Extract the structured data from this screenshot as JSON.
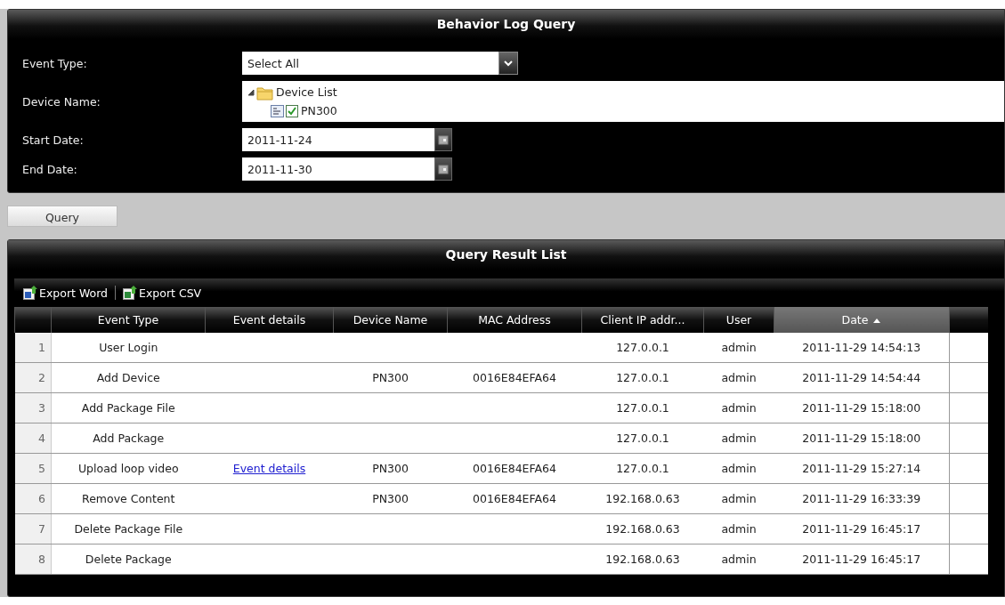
{
  "query_panel": {
    "title": "Behavior Log Query",
    "event_type": {
      "label": "Event Type:",
      "value": "Select All"
    },
    "device_name": {
      "label": "Device Name:",
      "tree": [
        {
          "label": "Device List",
          "expanded": true,
          "children": [
            {
              "label": "PN300",
              "checked": true
            }
          ]
        }
      ]
    },
    "start_date": {
      "label": "Start Date:",
      "value": "2011-11-24"
    },
    "end_date": {
      "label": "End Date:",
      "value": "2011-11-30"
    }
  },
  "query_button": "Query",
  "result_panel": {
    "title": "Query Result List",
    "toolbar": [
      {
        "label": "Export Word",
        "kind": "word"
      },
      {
        "label": "Export CSV",
        "kind": "excel"
      }
    ],
    "table": {
      "columns": [
        {
          "label": "Event Type",
          "sorted": false
        },
        {
          "label": "Event details",
          "sorted": false
        },
        {
          "label": "Device Name",
          "sorted": false
        },
        {
          "label": "MAC Address",
          "sorted": false
        },
        {
          "label": "Client IP addr...",
          "sorted": false
        },
        {
          "label": "User",
          "sorted": false
        },
        {
          "label": "Date",
          "sorted": true
        }
      ],
      "rows": [
        {
          "number": "1",
          "cells": [
            "User Login",
            null,
            null,
            null,
            "127.0.0.1",
            "admin",
            "2011-11-29 14:54:13"
          ]
        },
        {
          "number": "2",
          "cells": [
            "Add Device",
            null,
            "PN300",
            "0016E84EFA64",
            "127.0.0.1",
            "admin",
            "2011-11-29 14:54:44"
          ]
        },
        {
          "number": "3",
          "cells": [
            "Add Package File",
            null,
            null,
            null,
            "127.0.0.1",
            "admin",
            "2011-11-29 15:18:00"
          ]
        },
        {
          "number": "4",
          "cells": [
            "Add Package",
            null,
            null,
            null,
            "127.0.0.1",
            "admin",
            "2011-11-29 15:18:00"
          ]
        },
        {
          "number": "5",
          "cells": [
            "Upload loop video",
            {
              "text": "Event details",
              "kind": "link"
            },
            "PN300",
            "0016E84EFA64",
            "127.0.0.1",
            "admin",
            "2011-11-29 15:27:14"
          ]
        },
        {
          "number": "6",
          "cells": [
            "Remove Content",
            null,
            "PN300",
            "0016E84EFA64",
            "192.168.0.63",
            "admin",
            "2011-11-29 16:33:39"
          ]
        },
        {
          "number": "7",
          "cells": [
            "Delete Package File",
            null,
            null,
            null,
            "192.168.0.63",
            "admin",
            "2011-11-29 16:45:17"
          ]
        },
        {
          "number": "8",
          "cells": [
            "Delete Package",
            null,
            null,
            null,
            "192.168.0.63",
            "admin",
            "2011-11-29 16:45:17"
          ]
        }
      ]
    }
  }
}
